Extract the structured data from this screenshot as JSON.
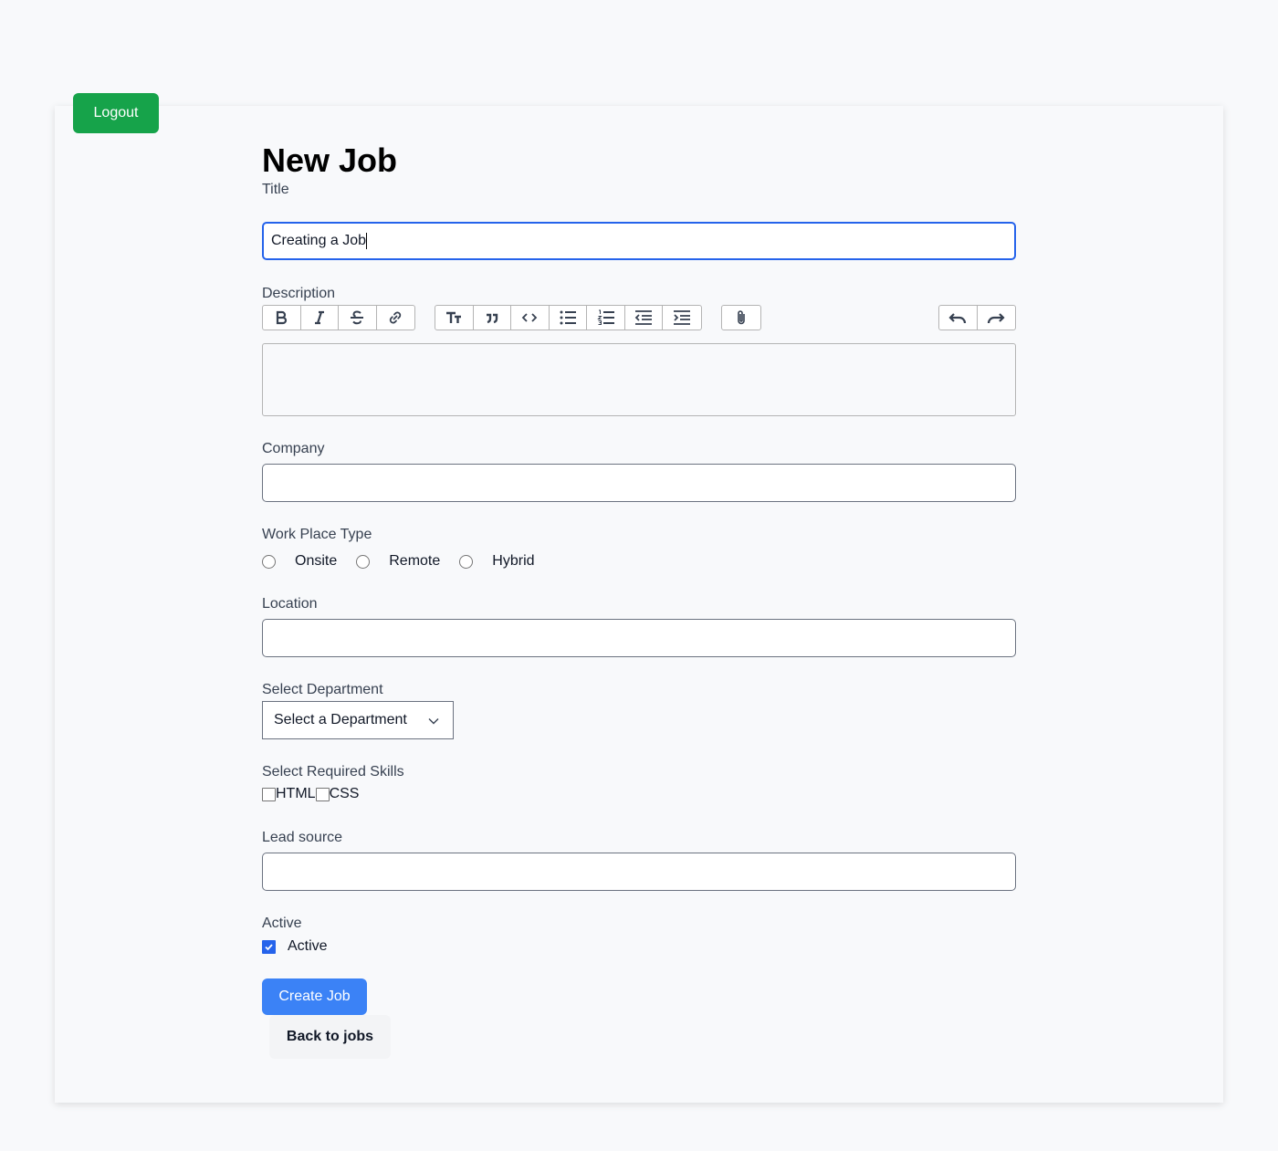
{
  "header": {
    "logout_label": "Logout"
  },
  "page": {
    "title": "New Job"
  },
  "form": {
    "title_label": "Title",
    "title_value": "Creating a Job",
    "description_label": "Description",
    "description_value": "",
    "company_label": "Company",
    "company_value": "",
    "workplace_label": "Work Place Type",
    "workplace_options": [
      "Onsite",
      "Remote",
      "Hybrid"
    ],
    "location_label": "Location",
    "location_value": "",
    "department_label": "Select Department",
    "department_selected": "Select a Department",
    "skills_label": "Select Required Skills",
    "skills": [
      {
        "label": "HTML",
        "checked": false
      },
      {
        "label": "CSS",
        "checked": false
      }
    ],
    "lead_source_label": "Lead source",
    "lead_source_value": "",
    "active_label": "Active",
    "active_checkbox_label": "Active",
    "active_checked": true,
    "submit_label": "Create Job",
    "back_label": "Back to jobs"
  },
  "toolbar": {
    "text_tools": [
      "bold-icon",
      "italic-icon",
      "strikethrough-icon",
      "link-icon"
    ],
    "block_tools": [
      "heading-icon",
      "quote-icon",
      "code-icon",
      "bullet-list-icon",
      "numbered-list-icon",
      "outdent-icon",
      "indent-icon"
    ],
    "file_tools": [
      "attach-icon"
    ],
    "history_tools": [
      "undo-icon",
      "redo-icon"
    ]
  },
  "colors": {
    "logout": "#16a34a",
    "primary": "#3b82f6",
    "focus": "#2563eb",
    "background": "#f8f9fb"
  }
}
